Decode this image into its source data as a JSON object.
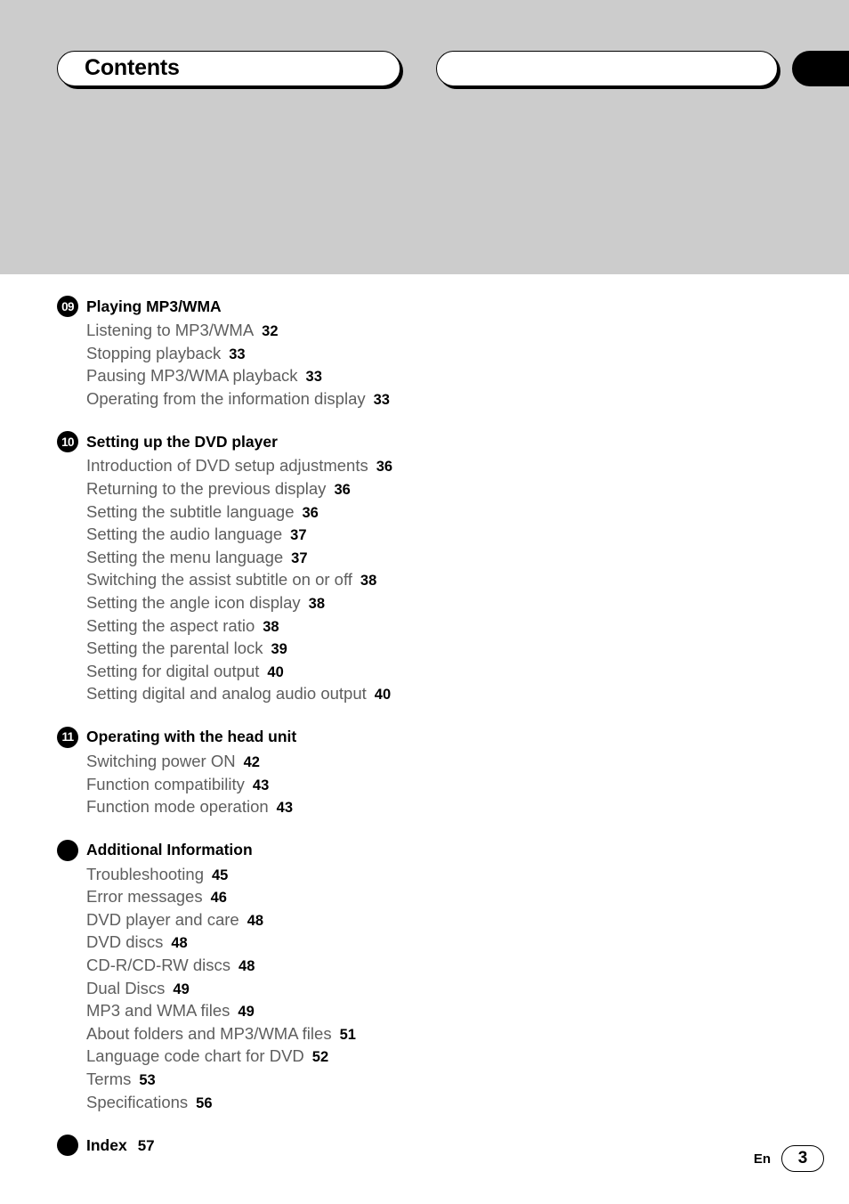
{
  "header": {
    "title": "Contents",
    "blank_tab_label": "",
    "black_tab_label": ""
  },
  "toc": {
    "sections": [
      {
        "badge": "09",
        "badge_style": "number",
        "title": "Playing MP3/WMA",
        "page": "",
        "entries": [
          {
            "label": "Listening to MP3/WMA",
            "page": "32"
          },
          {
            "label": "Stopping playback",
            "page": "33"
          },
          {
            "label": "Pausing MP3/WMA playback",
            "page": "33"
          },
          {
            "label": "Operating from the information display",
            "page": "33"
          }
        ]
      },
      {
        "badge": "10",
        "badge_style": "number",
        "title": "Setting up the DVD player",
        "page": "",
        "entries": [
          {
            "label": "Introduction of DVD setup adjustments",
            "page": "36"
          },
          {
            "label": "Returning to the previous display",
            "page": "36"
          },
          {
            "label": "Setting the subtitle language",
            "page": "36"
          },
          {
            "label": "Setting the audio language",
            "page": "37"
          },
          {
            "label": "Setting the menu language",
            "page": "37"
          },
          {
            "label": "Switching the assist subtitle on or off",
            "page": "38"
          },
          {
            "label": "Setting the angle icon display",
            "page": "38"
          },
          {
            "label": "Setting the aspect ratio",
            "page": "38"
          },
          {
            "label": "Setting the parental lock",
            "page": "39"
          },
          {
            "label": "Setting for digital output",
            "page": "40"
          },
          {
            "label": "Setting digital and analog audio output",
            "page": "40"
          }
        ]
      },
      {
        "badge": "11",
        "badge_style": "number",
        "title": "Operating with the head unit",
        "page": "",
        "entries": [
          {
            "label": "Switching power ON",
            "page": "42"
          },
          {
            "label": "Function compatibility",
            "page": "43"
          },
          {
            "label": "Function mode operation",
            "page": "43"
          }
        ]
      },
      {
        "badge": "",
        "badge_style": "dot",
        "title": "Additional Information",
        "page": "",
        "entries": [
          {
            "label": "Troubleshooting",
            "page": "45"
          },
          {
            "label": "Error messages",
            "page": "46"
          },
          {
            "label": "DVD player and care",
            "page": "48"
          },
          {
            "label": "DVD discs",
            "page": "48"
          },
          {
            "label": "CD-R/CD-RW discs",
            "page": "48"
          },
          {
            "label": "Dual Discs",
            "page": "49"
          },
          {
            "label": "MP3 and WMA files",
            "page": "49"
          },
          {
            "label": "About folders and MP3/WMA files",
            "page": "51"
          },
          {
            "label": "Language code chart for DVD",
            "page": "52"
          },
          {
            "label": "Terms",
            "page": "53"
          },
          {
            "label": "Specifications",
            "page": "56"
          }
        ]
      },
      {
        "badge": "",
        "badge_style": "dot",
        "title": "Index",
        "page": "57",
        "entries": []
      }
    ]
  },
  "footer": {
    "language": "En",
    "page_number": "3"
  },
  "colors": {
    "band": "#cccccc",
    "entry_text": "#5e5e5e",
    "accent": "#000000"
  }
}
